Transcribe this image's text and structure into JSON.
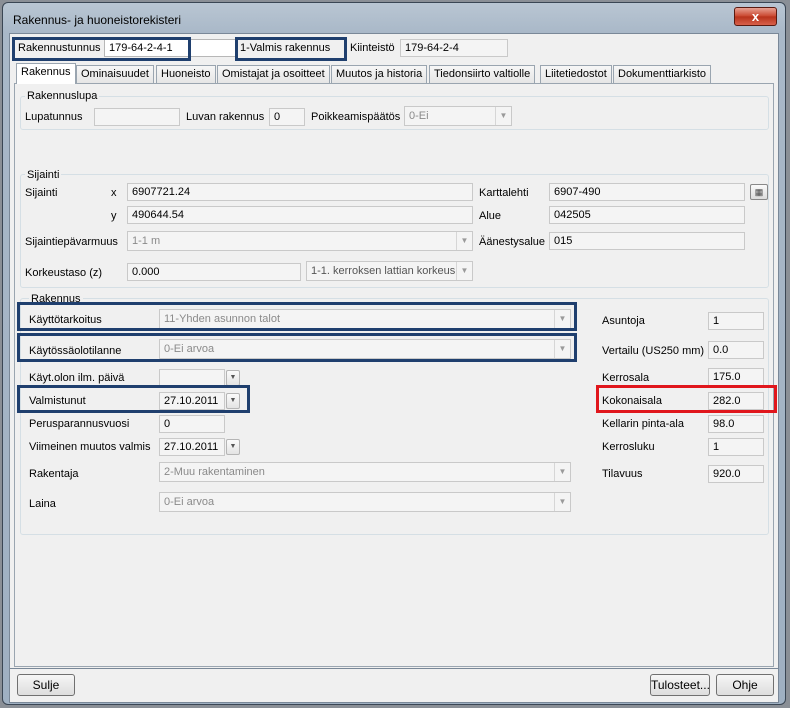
{
  "window": {
    "title": "Rakennus- ja huoneistorekisteri",
    "close_label": "x"
  },
  "header": {
    "rakennustunnus_label": "Rakennustunnus",
    "rakennustunnus_value": "179-64-2-4-1",
    "status_text": "1-Valmis rakennus",
    "kiinteisto_label": "Kiinteistö",
    "kiinteisto_value": "179-64-2-4"
  },
  "tabs": [
    {
      "label": "Rakennus"
    },
    {
      "label": "Ominaisuudet"
    },
    {
      "label": "Huoneisto"
    },
    {
      "label": "Omistajat ja osoitteet"
    },
    {
      "label": "Muutos ja historia"
    },
    {
      "label": "Tiedonsiirto valtiolle"
    },
    {
      "label": "Liitetiedostot"
    },
    {
      "label": "Dokumenttiarkisto"
    }
  ],
  "rakennuslupa": {
    "group_title": "Rakennuslupa",
    "lupatunnus_label": "Lupatunnus",
    "lupatunnus_value": "",
    "luvan_rakennus_label": "Luvan rakennus",
    "luvan_rakennus_value": "0",
    "poikkeamispaatos_label": "Poikkeamispäätös",
    "poikkeamispaatos_value": "0-Ei"
  },
  "sijainti": {
    "group_title": "Sijainti",
    "sijainti_label": "Sijainti",
    "x_label": "x",
    "x_value": "6907721.24",
    "y_label": "y",
    "y_value": "490644.54",
    "karttalehti_label": "Karttalehti",
    "karttalehti_value": "6907-490",
    "alue_label": "Alue",
    "alue_value": "042505",
    "epavarmuus_label": "Sijaintiepävarmuus",
    "epavarmuus_value": "1-1 m",
    "aanestysalue_label": "Äänestysalue",
    "aanestysalue_value": "015",
    "korkeustaso_label": "Korkeustaso (z)",
    "korkeustaso_value": "0.000",
    "korkeus_combo_value": "1-1. kerroksen lattian korkeus"
  },
  "rakennus": {
    "group_title": "Rakennus",
    "kayttotarkoitus_label": "Käyttötarkoitus",
    "kayttotarkoitus_value": "11-Yhden asunnon talot",
    "kaytossaolotilanne_label": "Käytössäolotilanne",
    "kaytossaolotilanne_value": "0-Ei arvoa",
    "kayt_olon_label": "Käyt.olon ilm. päivä",
    "kayt_olon_value": "",
    "valmistunut_label": "Valmistunut",
    "valmistunut_value": "27.10.2011",
    "perusparannus_label": "Perusparannusvuosi",
    "perusparannus_value": "0",
    "viimeinen_label": "Viimeinen muutos valmis",
    "viimeinen_value": "27.10.2011",
    "rakentaja_label": "Rakentaja",
    "rakentaja_value": "2-Muu rakentaminen",
    "laina_label": "Laina",
    "laina_value": "0-Ei arvoa",
    "asuntoja_label": "Asuntoja",
    "asuntoja_value": "1",
    "vertailu_label": "Vertailu (US250 mm)",
    "vertailu_value": "0.0",
    "kerrosala_label": "Kerrosala",
    "kerrosala_value": "175.0",
    "kokonaisala_label": "Kokonaisala",
    "kokonaisala_value": "282.0",
    "kellarin_label": "Kellarin pinta-ala",
    "kellarin_value": "98.0",
    "kerrosluku_label": "Kerrosluku",
    "kerrosluku_value": "1",
    "tilavuus_label": "Tilavuus",
    "tilavuus_value": "920.0"
  },
  "footer": {
    "sulje_label": "Sulje",
    "tulosteet_label": "Tulosteet...",
    "ohje_label": "Ohje"
  },
  "colors": {
    "highlight_blue": "#1f3f6e",
    "highlight_red": "#e0161c"
  }
}
